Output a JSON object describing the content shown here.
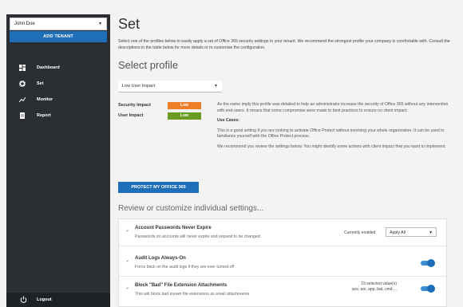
{
  "sidebar": {
    "tenant": "John Doe",
    "add_tenant": "ADD TENANT",
    "items": [
      {
        "label": "Dashboard",
        "icon": "dashboard-icon"
      },
      {
        "label": "Set",
        "icon": "gear-icon"
      },
      {
        "label": "Monitor",
        "icon": "trend-icon"
      },
      {
        "label": "Report",
        "icon": "report-icon"
      }
    ],
    "logout": "Logout"
  },
  "main": {
    "title": "Set",
    "intro": "Select one of the profiles below to easily apply a set of Office 365 security settings to your tenant. We recommend the strongest profile your company is comfortable with. Consult the descriptions in the table below for more details or to customise the configuration.",
    "select_profile_title": "Select profile",
    "profile_value": "Low User Impact",
    "security_impact_label": "Security Impact",
    "security_impact_value": "Low",
    "user_impact_label": "User Impact",
    "user_impact_value": "Low",
    "desc_p1": "As the name imply this profile was detailed to help an administrator increase the security of Office 365 without any intervention with end-users. It means that some compromise were made to best practices to ensure no client impact.",
    "use_cases_title": "Use Cases:",
    "desc_p2": "This is a good setting if you are looking to activate Office Protect without involving your whole organization. It can be used to familiarize yourself with the Office Protect process.",
    "desc_p3": "We recommend you review the settings below. You might identify some actions with client impact that you want to implement.",
    "protect_button": "PROTECT MY OFFICE 365",
    "review_title": "Review or customize individual settings...",
    "settings": [
      {
        "title": "Account Passwords Never Expire",
        "sub": "Passwords on accounts will never expire and request to be changed.",
        "currently": "Currently enabled",
        "apply": "Apply All"
      },
      {
        "title": "Audit Logs Always-On",
        "sub": "Force back on the audit logs if they are ever turned off"
      },
      {
        "title": "Block \"Bad\" File Extension Attachments",
        "sub": "This will block bad known file extensions as email attachments",
        "selected": "19 selected value(s)",
        "selected_detail": "ace, ani, app, bat, cmd ..."
      }
    ]
  },
  "colors": {
    "accent": "#1f6fb8",
    "impact_low_security": "#f07d27",
    "impact_low_user": "#6a9a1f",
    "sidebar": "#2b2f33"
  }
}
